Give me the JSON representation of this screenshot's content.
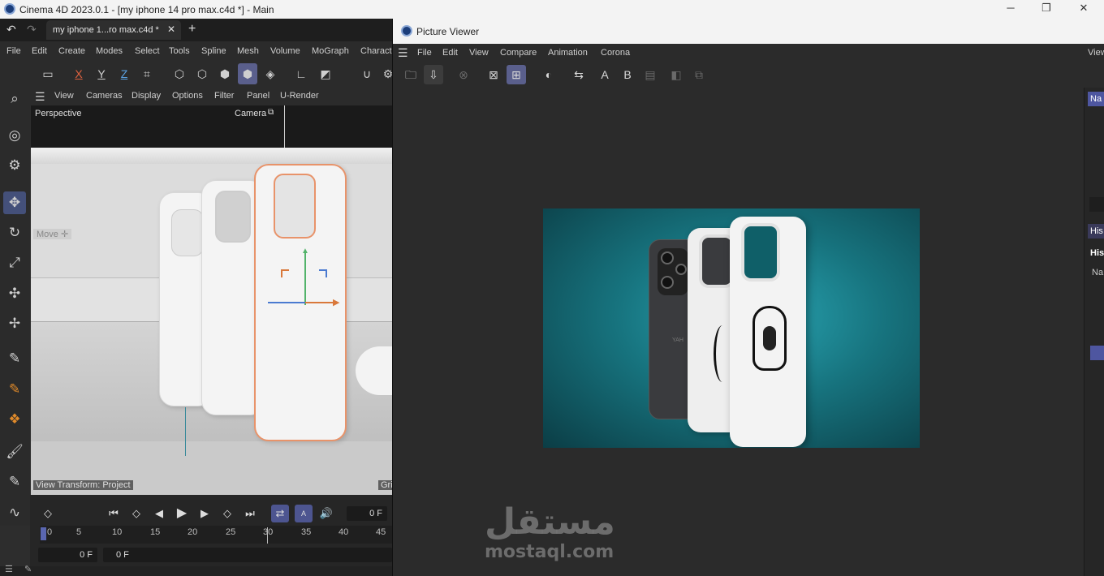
{
  "c4d": {
    "window_title": "Cinema 4D 2023.0.1 - [my iphone 14 pro max.c4d *] - Main",
    "doc_tab": "my iphone 1...ro max.c4d *",
    "menu": [
      "File",
      "Edit",
      "Create",
      "Modes",
      "Select",
      "Tools",
      "Spline",
      "Mesh",
      "Volume",
      "MoGraph",
      "Characte"
    ],
    "axis_labels": [
      "X",
      "Y",
      "Z"
    ],
    "viewport_menu": [
      "View",
      "Cameras",
      "Display",
      "Options",
      "Filter",
      "Panel",
      "U-Render"
    ],
    "viewport_name": "Perspective",
    "camera_label": "Camera",
    "move_hud": "Move",
    "view_transform": "View Transform: Project",
    "grid_label": "Gri",
    "current_frame": "0 F",
    "start_frame": "0 F",
    "range_start": "0 F",
    "ruler_ticks": [
      "0",
      "5",
      "10",
      "15",
      "20",
      "25",
      "30",
      "35",
      "40",
      "45"
    ],
    "auto_key_label": "A"
  },
  "pv": {
    "window_title": "Picture Viewer",
    "menu": [
      "File",
      "Edit",
      "View",
      "Compare",
      "Animation",
      "Corona"
    ],
    "right_view_label": "View",
    "compare_a": "A",
    "compare_b": "B",
    "side_tabs": [
      "Na",
      "His",
      "His",
      "Na"
    ]
  },
  "render_image": {
    "brand_text": "YAH"
  },
  "watermark": {
    "arabic": "مستقل",
    "latin": "mostaql.com"
  },
  "colors": {
    "accent": "#5a5f8c",
    "selection_orange": "#e8936a",
    "render_bg": "#17747f"
  }
}
